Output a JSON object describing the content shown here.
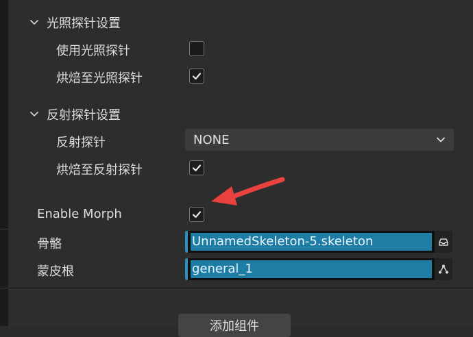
{
  "light_probe_section": {
    "title": "光照探针设置",
    "use_light_probe_label": "使用光照探针",
    "use_light_probe_checked": false,
    "bake_to_light_probe_label": "烘焙至光照探针",
    "bake_to_light_probe_checked": true
  },
  "reflection_probe_section": {
    "title": "反射探针设置",
    "reflection_probe_label": "反射探针",
    "reflection_probe_value": "NONE",
    "bake_to_reflection_probe_label": "烘焙至反射探针",
    "bake_to_reflection_probe_checked": true
  },
  "morph": {
    "label": "Enable Morph",
    "checked": true
  },
  "skeleton": {
    "label": "骨骼",
    "value": "UnnamedSkeleton-5.skeleton"
  },
  "skin_root": {
    "label": "蒙皮根",
    "value": "general_1"
  },
  "footer": {
    "add_component_label": "添加组件"
  },
  "colors": {
    "accent": "#1e7da4",
    "annotation_arrow": "#e8413e"
  },
  "icons": {
    "section_toggle": "chevron-down-icon",
    "select_caret": "chevron-down-icon",
    "asset_locate": "asset-folder-icon",
    "node_locate": "node-tree-icon"
  }
}
